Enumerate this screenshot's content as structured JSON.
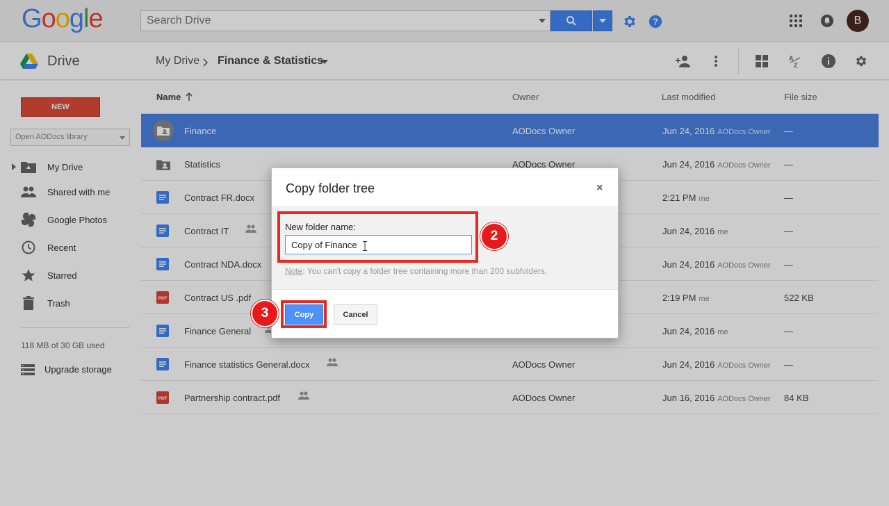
{
  "header": {
    "logo_text": "Google",
    "search_placeholder": "Search Drive",
    "avatar_initial": "B"
  },
  "subbar": {
    "app_name": "Drive",
    "breadcrumb": [
      {
        "label": "My Drive"
      },
      {
        "label": "Finance & Statistics"
      }
    ]
  },
  "sidebar": {
    "new_label": "NEW",
    "library_select": "Open AODocs library",
    "items": [
      {
        "label": "My Drive",
        "icon": "my-drive-icon"
      },
      {
        "label": "Shared with me",
        "icon": "people-icon"
      },
      {
        "label": "Google Photos",
        "icon": "photos-icon"
      },
      {
        "label": "Recent",
        "icon": "clock-icon"
      },
      {
        "label": "Starred",
        "icon": "star-icon"
      },
      {
        "label": "Trash",
        "icon": "trash-icon"
      }
    ],
    "quota": "118 MB of 30 GB used",
    "upgrade_label": "Upgrade storage"
  },
  "list": {
    "columns": {
      "name": "Name",
      "owner": "Owner",
      "modified": "Last modified",
      "size": "File size"
    },
    "rows": [
      {
        "name": "Finance",
        "type": "shared-folder",
        "owner": "AODocs Owner",
        "modified": "Jun 24, 2016",
        "modified_by": "AODocs Owner",
        "size": "—",
        "shared": false
      },
      {
        "name": "Statistics",
        "type": "shared-folder",
        "owner": "AODocs Owner",
        "modified": "Jun 24, 2016",
        "modified_by": "AODocs Owner",
        "size": "—",
        "shared": false
      },
      {
        "name": "Contract FR.docx",
        "type": "doc",
        "owner": "",
        "modified": "2:21 PM",
        "modified_by": "me",
        "size": "—",
        "shared": false
      },
      {
        "name": "Contract IT",
        "type": "doc",
        "owner": "",
        "modified": "Jun 24, 2016",
        "modified_by": "me",
        "size": "—",
        "shared": true
      },
      {
        "name": "Contract NDA.docx",
        "type": "doc",
        "owner": "",
        "modified": "Jun 24, 2016",
        "modified_by": "AODocs Owner",
        "size": "—",
        "shared": false
      },
      {
        "name": "Contract US .pdf",
        "type": "pdf",
        "owner": "",
        "modified": "2:19 PM",
        "modified_by": "me",
        "size": "522 KB",
        "shared": false
      },
      {
        "name": "Finance General",
        "type": "doc",
        "owner": "",
        "modified": "Jun 24, 2016",
        "modified_by": "me",
        "size": "—",
        "shared": true
      },
      {
        "name": "Finance statistics General.docx",
        "type": "doc",
        "owner": "AODocs Owner",
        "modified": "Jun 24, 2016",
        "modified_by": "AODocs Owner",
        "size": "—",
        "shared": true
      },
      {
        "name": "Partnership contract.pdf",
        "type": "pdf",
        "owner": "AODocs Owner",
        "modified": "Jun 16, 2016",
        "modified_by": "AODocs Owner",
        "size": "84 KB",
        "shared": true
      }
    ]
  },
  "dialog": {
    "title": "Copy folder tree",
    "close": "×",
    "field_label": "New folder name:",
    "field_value": "Copy of Finance",
    "note_prefix": "Note",
    "note_text": ": You can't copy a folder tree containing more than 200 subfolders.",
    "copy_label": "Copy",
    "cancel_label": "Cancel"
  },
  "annotations": {
    "step_field": "2",
    "step_copy": "3",
    "highlight_color": "#e8281e"
  },
  "colors": {
    "accent": "#4285f4",
    "new_button": "#dd4b39",
    "selected_row": "#4b82e0"
  }
}
